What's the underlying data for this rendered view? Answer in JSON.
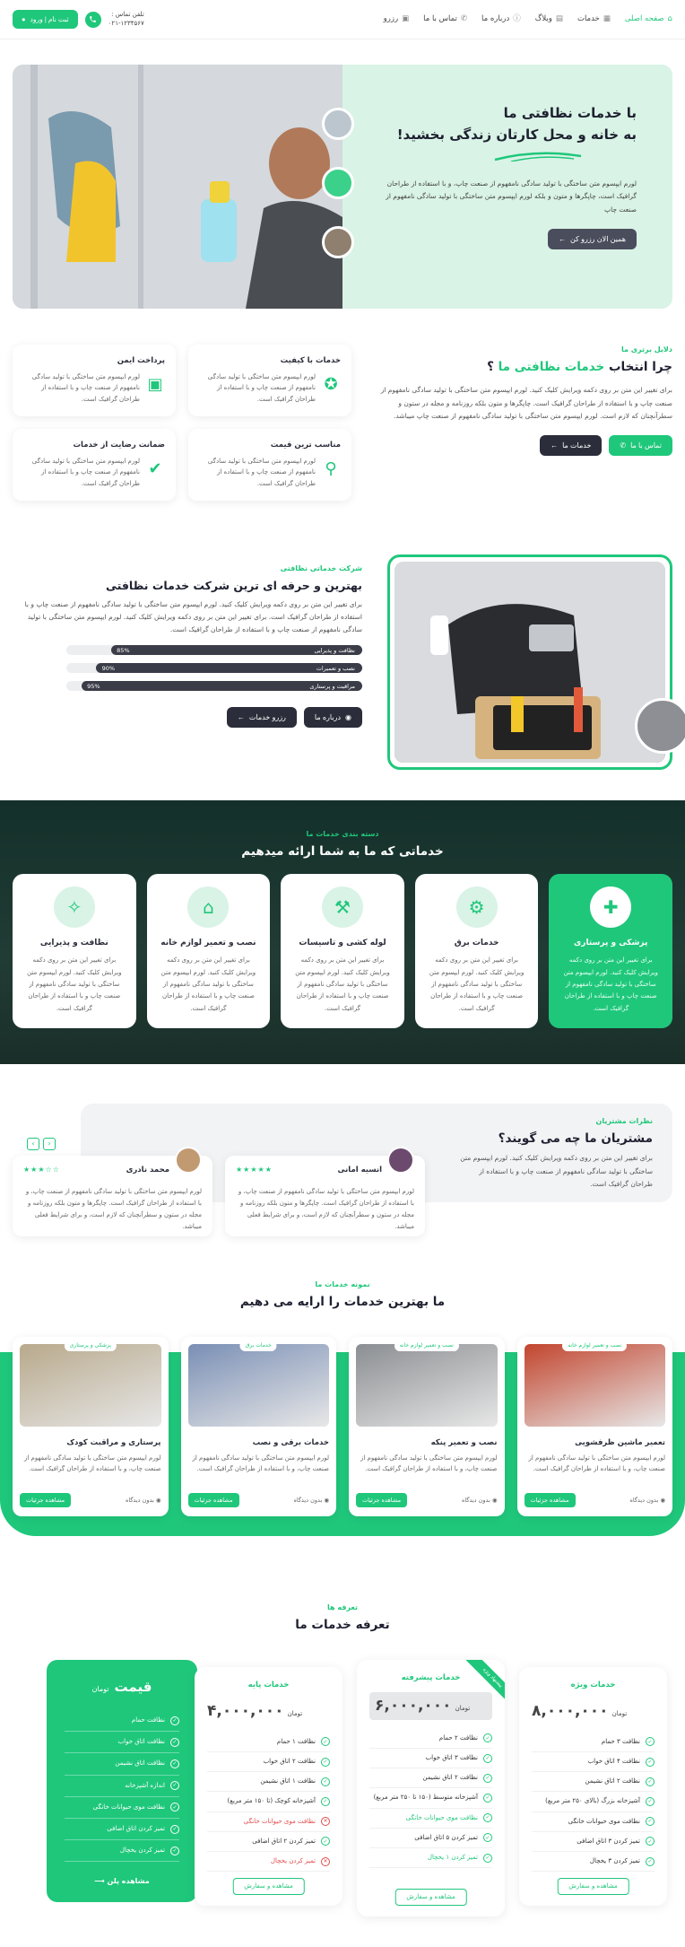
{
  "header": {
    "nav": [
      {
        "label": "صفحه اصلی",
        "icon": "home-icon",
        "active": true
      },
      {
        "label": "خدمات",
        "icon": "layers-icon",
        "active": false
      },
      {
        "label": "وبلاگ",
        "icon": "book-icon",
        "active": false
      },
      {
        "label": "درباره ما",
        "icon": "info-icon",
        "active": false
      },
      {
        "label": "تماس با ما",
        "icon": "phone-icon",
        "active": false
      },
      {
        "label": "رزرو",
        "icon": "calendar-icon",
        "active": false
      }
    ],
    "phone_label": "تلفن تماس :",
    "phone_number": "۰۲۱-۱۲۳۴۵۶۷",
    "login_button": "ثبت نام | ورود"
  },
  "hero": {
    "title_line1": "با خدمات نظافتی ما",
    "title_line2": "به خانه و محل کارتان زندگی  بخشید!",
    "description": "لورم ایپسوم متن ساختگی با تولید سادگی نامفهوم از صنعت چاپ، و با استفاده از طراحان گرافیک است، چاپگرها و متون و بلکه لورم ایپسوم متن ساختگی با تولید سادگی نامفهوم از صنعت چاپ",
    "cta": "همین الان رزرو کن"
  },
  "why": {
    "subtitle": "دلایل برتری ما",
    "title_prefix": "چرا انتخاب",
    "title_highlight": "خدمات نظافتی ما",
    "title_suffix": "؟",
    "description": "برای تغییر این متن بر روی دکمه ویرایش کلیک کنید. لورم ایپسوم متن ساختگی با تولید سادگی نامفهوم از صنعت چاپ و با استفاده از طراحان گرافیک است. چاپگرها و متون بلکه روزنامه و مجله در ستون و سطرآنچنان که لازم است. لورم ایپسوم متن ساختگی با تولید سادگی نامفهوم از صنعت چاپ میباشد.",
    "btn_contact": "تماس با ما",
    "btn_services": "خدمات ما",
    "cards": [
      {
        "title": "خدمات با کیفیت",
        "text": "لورم ایپسوم متن ساختگی با تولید سادگی نامفهوم از صنعت چاپ و با استفاده از طراحان گرافیک است.",
        "icon": "badge-icon"
      },
      {
        "title": "پرداخت ایمن",
        "text": "لورم ایپسوم متن ساختگی با تولید سادگی نامفهوم از صنعت چاپ و با استفاده از طراحان گرافیک است.",
        "icon": "wallet-icon"
      },
      {
        "title": "مناسب ترین قیمت",
        "text": "لورم ایپسوم متن ساختگی با تولید سادگی نامفهوم از صنعت چاپ و با استفاده از طراحان گرافیک است.",
        "icon": "price-tag-icon"
      },
      {
        "title": "ضمانت رضایت از خدمات",
        "text": "لورم ایپسوم متن ساختگی با تولید سادگی نامفهوم از صنعت چاپ و با استفاده از طراحان گرافیک است.",
        "icon": "check-circle-icon"
      }
    ]
  },
  "about": {
    "subtitle": "شرکت خدماتی نظافتی",
    "title": "بهترین و حرفه ای ترین شرکت خدمات نظافتی",
    "description": "برای تغییر این متن بر روی دکمه ویرایش کلیک کنید. لورم ایپسوم متن ساختگی با تولید سادگی نامفهوم از صنعت چاپ و با استفاده از طراحان گرافیک است. برای تغییر این متن بر روی دکمه ویرایش کلیک کنید. لورم ایپسوم متن ساختگی با تولید سادگی نامفهوم از صنعت چاپ و با استفاده از طراحان گرافیک است.",
    "skills": [
      {
        "label": "نظافت و پذیرایی",
        "percent": 85,
        "percent_label": "85%"
      },
      {
        "label": "نصب و تعمیرات",
        "percent": 90,
        "percent_label": "90%"
      },
      {
        "label": "مراقبت و پرستاری",
        "percent": 95,
        "percent_label": "95%"
      }
    ],
    "btn_about": "درباره ما",
    "btn_reserve": "رزرو خدمات"
  },
  "services": {
    "subtitle": "دسته بندی خدمات ما",
    "title": "خدماتی که ما به شما ارائه میدهیم",
    "cards": [
      {
        "title": "پزشکی و پرستاری",
        "text": "برای تغییر این متن بر روی دکمه ویرایش کلیک کنید. لورم ایپسوم متن ساختگی با تولید سادگی نامفهوم از صنعت چاپ و با استفاده از طراحان گرافیک است.",
        "icon": "first-aid-icon",
        "featured": true
      },
      {
        "title": "خدمات برق",
        "text": "برای تغییر این متن بر روی دکمه ویرایش کلیک کنید. لورم ایپسوم متن ساختگی با تولید سادگی نامفهوم از صنعت چاپ و با استفاده از طراحان گرافیک است.",
        "icon": "gear-icon",
        "featured": false
      },
      {
        "title": "لوله کشی و تاسیسات",
        "text": "برای تغییر این متن بر روی دکمه ویرایش کلیک کنید. لورم ایپسوم متن ساختگی با تولید سادگی نامفهوم از صنعت چاپ و با استفاده از طراحان گرافیک است.",
        "icon": "faucet-icon",
        "featured": false
      },
      {
        "title": "نصب و تعمیر لوازم خانه",
        "text": "برای تغییر این متن بر روی دکمه ویرایش کلیک کنید. لورم ایپسوم متن ساختگی با تولید سادگی نامفهوم از صنعت چاپ و با استفاده از طراحان گرافیک است.",
        "icon": "house-tools-icon",
        "featured": false
      },
      {
        "title": "نظافت و پذیرایی",
        "text": "برای تغییر این متن بر روی دکمه ویرایش کلیک کنید. لورم ایپسوم متن ساختگی با تولید سادگی نامفهوم از صنعت چاپ و با استفاده از طراحان گرافیک است.",
        "icon": "spray-icon",
        "featured": false
      }
    ]
  },
  "testimonials": {
    "subtitle": "نظرات مشتریان",
    "title": "مشتریان ما چه می گویند؟",
    "description": "برای تغییر این متن بر روی دکمه ویرایش کلیک کنید. لورم ایپسوم متن ساختگی با تولید سادگی نامفهوم از صنعت چاپ و با استفاده از طراحان گرافیک است.",
    "items": [
      {
        "name": "انسیه امانی",
        "stars": "★★★★★",
        "text": "لورم ایپسوم متن ساختگی با تولید سادگی نامفهوم از صنعت چاپ، و با استفاده از طراحان گرافیک است. چاپگرها و متون بلکه روزنامه و مجله در ستون و سطرآنچنان که لازم است، و برای شرایط فعلی میباشد."
      },
      {
        "name": "محمد نادری",
        "stars": "★★★☆☆",
        "text": "لورم ایپسوم متن ساختگی با تولید سادگی نامفهوم از صنعت چاپ، و با استفاده از طراحان گرافیک است. چاپگرها و متون بلکه روزنامه و مجله در ستون و سطرآنچنان که لازم است، و برای شرایط فعلی میباشد."
      }
    ]
  },
  "portfolio": {
    "subtitle": "نمونه خدمات ما",
    "title": "ما بهترین خدمات را ارایه می دهیم",
    "comments": "بدون دیدگاه",
    "more": "مشاهده جزئیات",
    "items": [
      {
        "tag": "نصب و تعمیر لوازم خانه",
        "title": "تعمیر ماشین ظرفشویی",
        "text": "لورم ایپسوم متن ساختگی با تولید سادگی نامفهوم از صنعت چاپ، و با استفاده از طراحان گرافیک است.",
        "color": "#c2452e"
      },
      {
        "tag": "نصب و تعمیر لوازم خانه",
        "title": "نصب و تعمیر پنکه",
        "text": "لورم ایپسوم متن ساختگی با تولید سادگی نامفهوم از صنعت چاپ، و با استفاده از طراحان گرافیک است.",
        "color": "#8b8e92"
      },
      {
        "tag": "خدمات برق",
        "title": "خدمات برقی و نصب",
        "text": "لورم ایپسوم متن ساختگی با تولید سادگی نامفهوم از صنعت چاپ، و با استفاده از طراحان گرافیک است.",
        "color": "#7a8fb5"
      },
      {
        "tag": "پزشکی و پرستاری",
        "title": "پرستاری و مراقبت کودک",
        "text": "لورم ایپسوم متن ساختگی با تولید سادگی نامفهوم از صنعت چاپ، و با استفاده از طراحان گرافیک است.",
        "color": "#b8a98c"
      }
    ]
  },
  "pricing": {
    "subtitle": "تعرفه ها",
    "title": "تعرفه خدمات ما",
    "currency": "تومان",
    "order": "مشاهده و سفارش",
    "plans": [
      {
        "name": "خدمات ویژه",
        "price": "۸,۰۰۰,۰۰۰",
        "features": [
          {
            "t": "نظافت ۳ حمام",
            "s": "ok"
          },
          {
            "t": "نظافت ۴ اتاق خواب",
            "s": "ok"
          },
          {
            "t": "نظافت ۲ اتاق نشیمن",
            "s": "ok"
          },
          {
            "t": "آشپزخانه بزرگ (بالای ۲۵۰ متر مربع)",
            "s": "ok"
          },
          {
            "t": "نظافت موی حیوانات خانگی",
            "s": "ok"
          },
          {
            "t": "تمیز کردن ۳ اتاق اضافی",
            "s": "ok"
          },
          {
            "t": "تمیز کردن ۳ یخچال",
            "s": "ok"
          }
        ]
      },
      {
        "name": "خدمات پیشرفته",
        "price": "۶,۰۰۰,۰۰۰",
        "ribbon": "پیشنهاد ویژه",
        "features": [
          {
            "t": "نظافت ۲ حمام",
            "s": "ok"
          },
          {
            "t": "نظافت ۳ اتاق خواب",
            "s": "ok"
          },
          {
            "t": "نظافت ۲ اتاق نشیمن",
            "s": "ok"
          },
          {
            "t": "آشپزخانه متوسط (۱۵۰ تا ۲۵۰ متر مربع)",
            "s": "ok"
          },
          {
            "t": "نظافت موی حیوانات خانگی",
            "s": "gr"
          },
          {
            "t": "تمیز کردن ۵ اتاق اضافی",
            "s": "ok"
          },
          {
            "t": "تمیز کردن ۱ یخچال",
            "s": "gr"
          }
        ]
      },
      {
        "name": "خدمات پایه",
        "price": "۴,۰۰۰,۰۰۰",
        "features": [
          {
            "t": "نظافت ۱ حمام",
            "s": "ok"
          },
          {
            "t": "نظافت ۲ اتاق خواب",
            "s": "ok"
          },
          {
            "t": "نظافت ۱ اتاق نشیمن",
            "s": "ok"
          },
          {
            "t": "آشپزخانه کوچک (تا ۱۵۰ متر مربع)",
            "s": "ok"
          },
          {
            "t": "نظافت موی حیوانات خانگی",
            "s": "no"
          },
          {
            "t": "تمیز کردن ۲ اتاق اضافی",
            "s": "ok"
          },
          {
            "t": "تمیز کردن یخچال",
            "s": "no"
          }
        ]
      }
    ],
    "green": {
      "title": "قیمت",
      "currency": "تومان",
      "features": [
        "نظافت حمام",
        "نظافت اتاق خواب",
        "نظافت اتاق نشیمن",
        "اندازه آشپزخانه",
        "نظافت موی حیوانات خانگی",
        "تمیز کردن اتاق اضافی",
        "تمیز کردن یخچال"
      ],
      "button": "مشاهده پلن"
    }
  }
}
